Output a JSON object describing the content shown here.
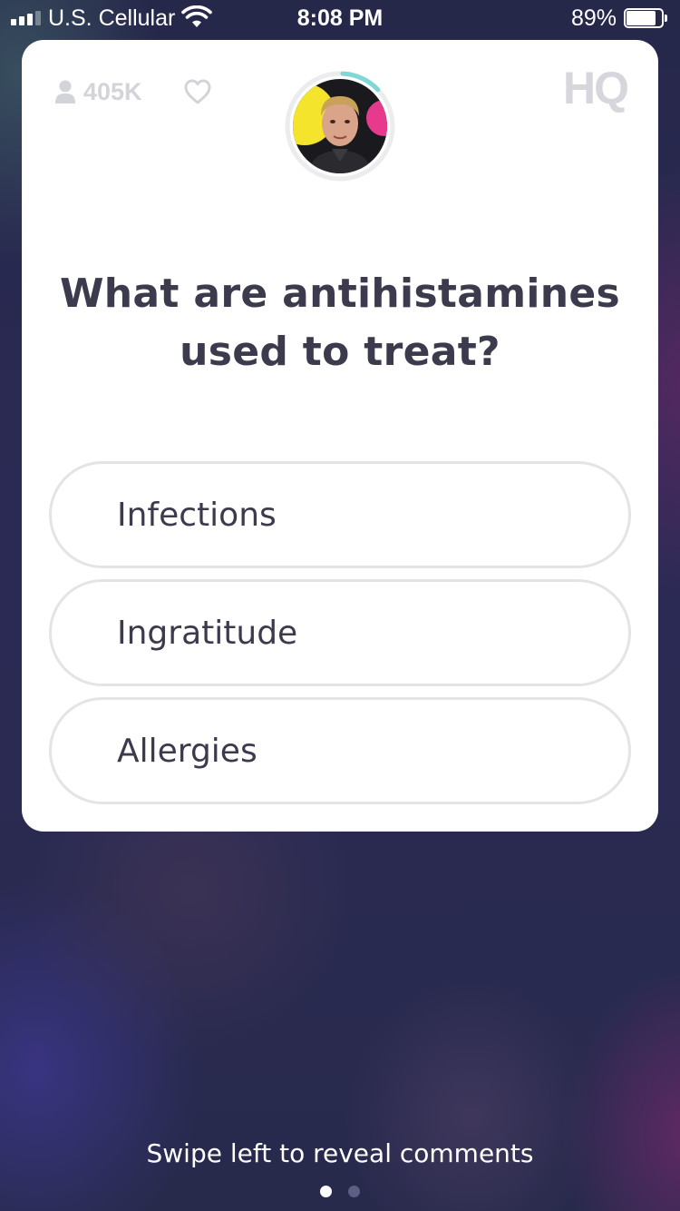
{
  "status_bar": {
    "carrier": "U.S. Cellular",
    "time": "8:08 PM",
    "battery_percent": "89%",
    "battery_level": 0.89,
    "signal_bars_filled": 3,
    "signal_bars_total": 4
  },
  "card": {
    "viewer_count": "405K",
    "logo": "HQ",
    "host_timer_fraction": 0.12,
    "question": "What are antihistamines used to treat?",
    "answers": [
      {
        "label": "Infections"
      },
      {
        "label": "Ingratitude"
      },
      {
        "label": "Allergies"
      }
    ]
  },
  "footer": {
    "hint": "Swipe left to reveal comments",
    "pages_total": 2,
    "page_active": 1
  },
  "colors": {
    "text_dark": "#3c3b4d",
    "answer_border": "#e4e4e6",
    "muted_gray": "#d3d3da",
    "timer_teal": "#7fd8d6",
    "dot_active": "#ffffff",
    "dot_inactive": "#5e5f85"
  },
  "icons": [
    "signal-icon",
    "wifi-icon",
    "battery-icon",
    "user-icon",
    "heart-icon",
    "hq-logo"
  ]
}
